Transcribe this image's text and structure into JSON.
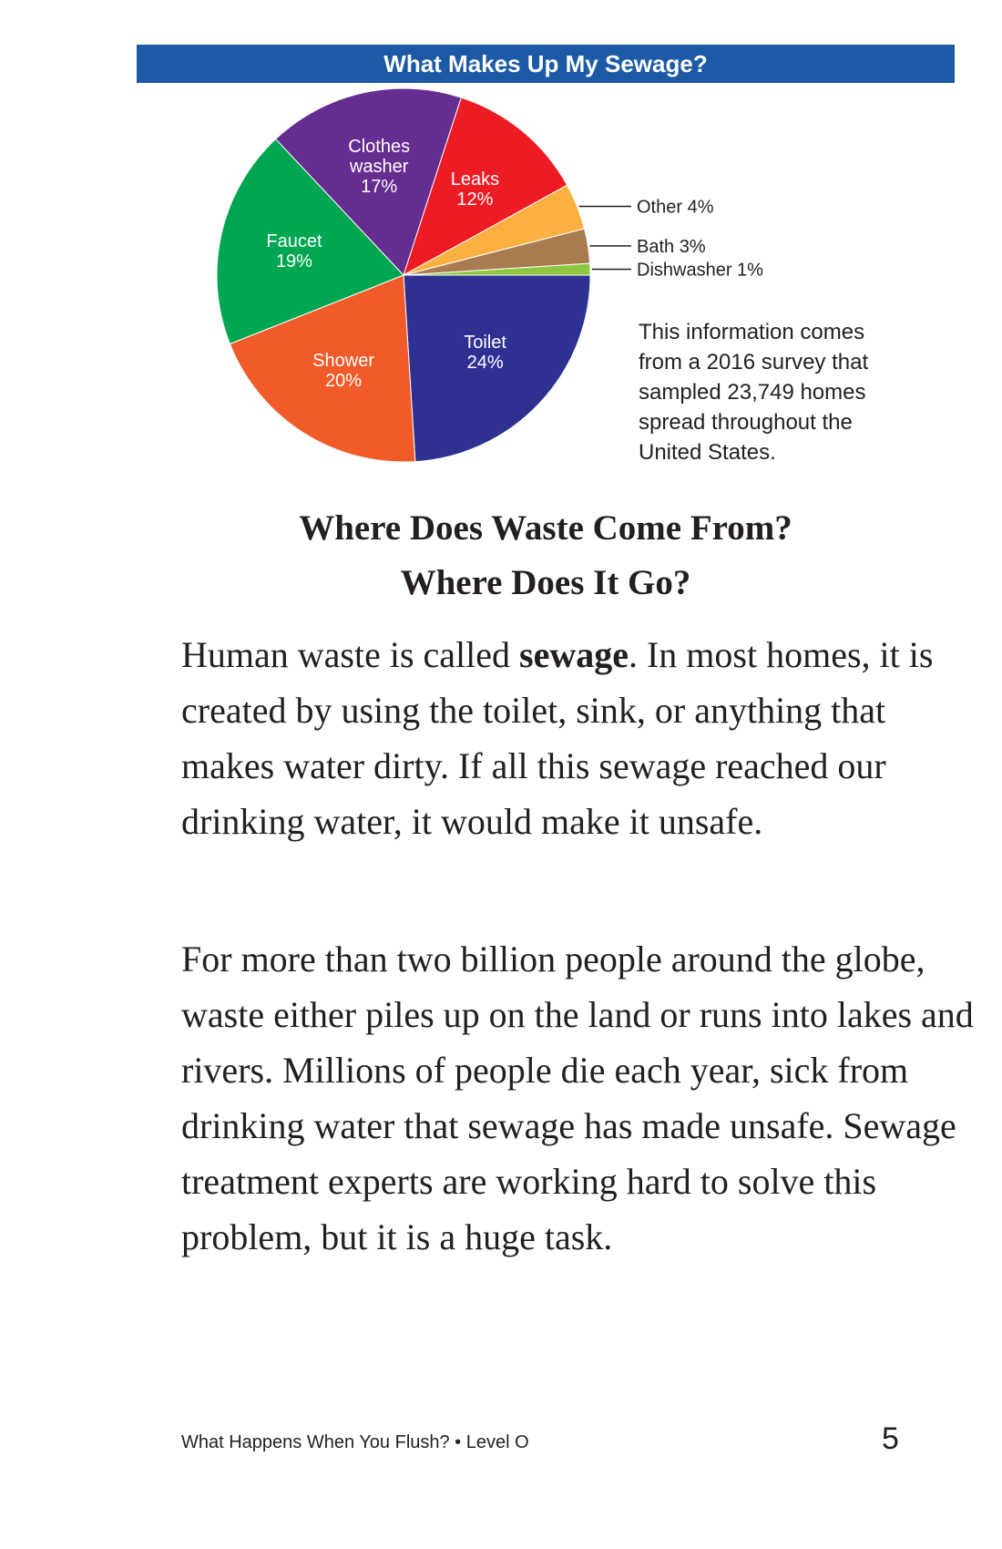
{
  "chart_data": {
    "type": "pie",
    "title": "What Makes Up My Sewage?",
    "unit": "%",
    "slices": [
      {
        "label": "Toilet",
        "value": 24,
        "color": "#2e3192"
      },
      {
        "label": "Shower",
        "value": 20,
        "color": "#f15a29"
      },
      {
        "label": "Faucet",
        "value": 19,
        "color": "#00a651"
      },
      {
        "label": "Clothes washer",
        "value": 17,
        "color": "#662d91"
      },
      {
        "label": "Leaks",
        "value": 12,
        "color": "#ed1c24"
      },
      {
        "label": "Other",
        "value": 4,
        "color": "#fbb040"
      },
      {
        "label": "Bath",
        "value": 3,
        "color": "#a97c50"
      },
      {
        "label": "Dishwasher",
        "value": 1,
        "color": "#8dc63f"
      }
    ],
    "note": "This information comes from a 2016 survey that sampled 23,749 homes spread throughout the United States."
  },
  "heading": {
    "line1": "Where Does Waste Come From?",
    "line2": "Where Does It Go?"
  },
  "paragraph1": {
    "before": "Human waste is called ",
    "term": "sewage",
    "after": ". In most homes, it is created by using the toilet, sink, or anything that makes water dirty. If all this sewage reached our drinking water, it would make it unsafe."
  },
  "paragraph2": "For more than two billion people around the globe, waste either piles up on the land or runs into lakes and rivers. Millions of people die each year, sick from drinking water that sewage has made unsafe. Sewage treatment experts are working hard to solve this problem, but it is a huge task.",
  "footer": {
    "book_title": "What Happens When You Flush? • Level O",
    "page_number": "5"
  }
}
